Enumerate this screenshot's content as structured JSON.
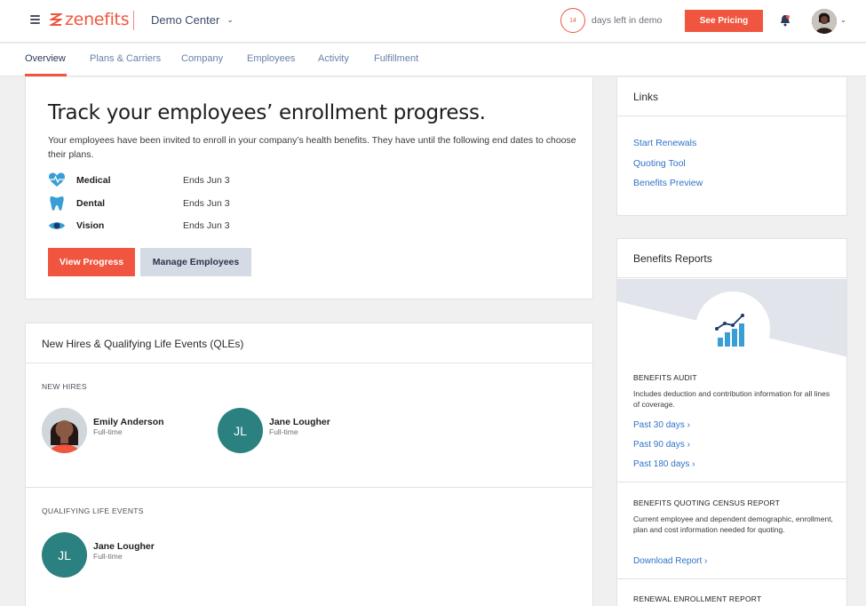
{
  "header": {
    "brand": "zenefits",
    "company": "Demo Center",
    "days_left": "14",
    "days_left_text": "days left in demo",
    "pricing_button": "See Pricing",
    "accent_color": "#f0563f"
  },
  "tabs": [
    {
      "label": "Overview"
    },
    {
      "label": "Plans & Carriers"
    },
    {
      "label": "Company"
    },
    {
      "label": "Employees"
    },
    {
      "label": "Activity"
    },
    {
      "label": "Fulfillment"
    }
  ],
  "hero": {
    "title": "Track your employees’ enrollment progress.",
    "description": "Your employees have been invited to enroll in your company’s health benefits. They have until the following end dates to choose their plans.",
    "benefits": [
      {
        "name": "Medical",
        "end": "Ends Jun 3",
        "icon": "heart-pulse-icon"
      },
      {
        "name": "Dental",
        "end": "Ends Jun 3",
        "icon": "tooth-icon"
      },
      {
        "name": "Vision",
        "end": "Ends Jun 3",
        "icon": "eye-icon"
      }
    ],
    "primary_button": "View Progress",
    "secondary_button": "Manage Employees"
  },
  "qle": {
    "title": "New Hires & Qualifying Life Events (QLEs)",
    "new_hires_label": "NEW HIRES",
    "new_hires": [
      {
        "name": "Emily Anderson",
        "role": "Full-time",
        "initials": ""
      },
      {
        "name": "Jane Lougher",
        "role": "Full-time",
        "initials": "JL"
      }
    ],
    "qle_label": "QUALIFYING LIFE EVENTS",
    "events": [
      {
        "name": "Jane Lougher",
        "role": "Full-time",
        "initials": "JL"
      }
    ]
  },
  "links_card": {
    "title": "Links",
    "items": [
      "Start Renewals",
      "Quoting Tool",
      "Benefits Preview"
    ]
  },
  "reports": {
    "title": "Benefits Reports",
    "audit_title": "BENEFITS AUDIT",
    "audit_desc": "Includes deduction and contribution information for all lines of coverage.",
    "audit_links": [
      "Past 30 days ›",
      "Past 90 days ›",
      "Past 180 days ›"
    ],
    "census_title": "BENEFITS QUOTING CENSUS REPORT",
    "census_desc": "Current employee and dependent demographic, enrollment, plan and cost information needed for quoting.",
    "census_link": "Download Report ›",
    "renewal_title": "RENEWAL ENROLLMENT REPORT"
  }
}
